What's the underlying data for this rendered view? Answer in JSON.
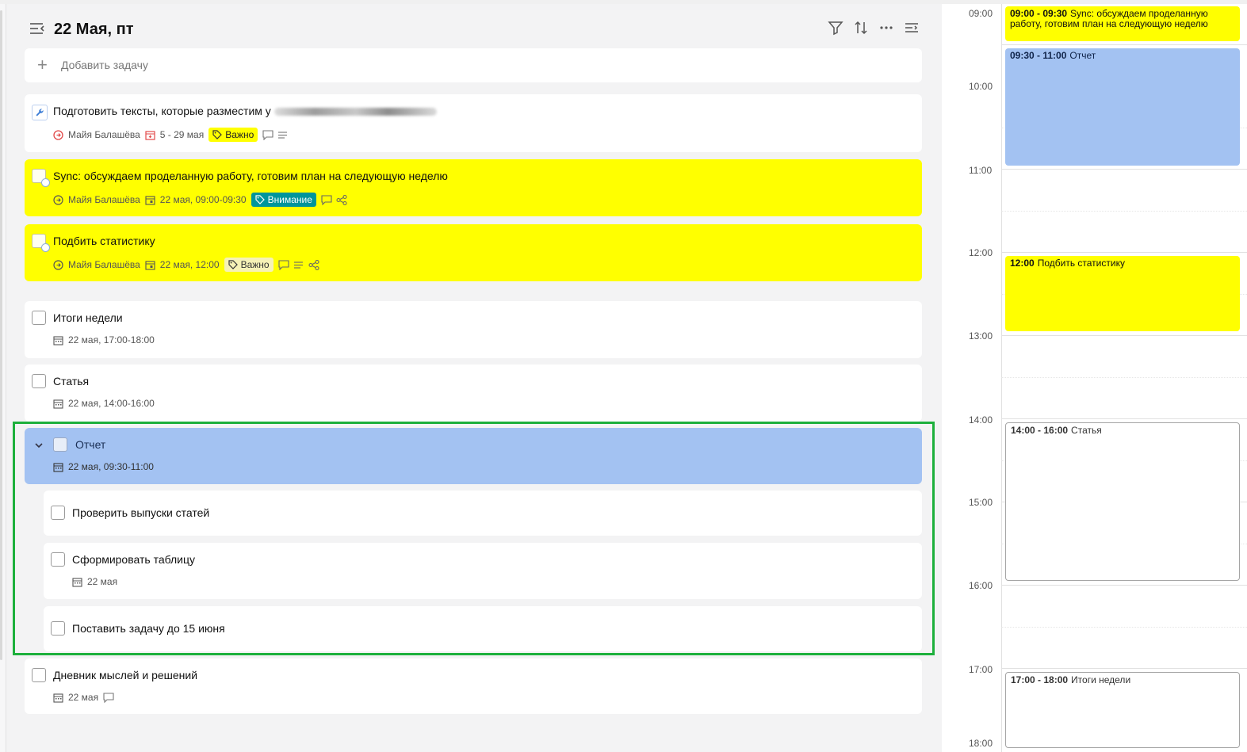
{
  "header": {
    "title": "22 Мая, пт"
  },
  "add_task": {
    "placeholder": "Добавить задачу",
    "plus": "+"
  },
  "tasks": [
    {
      "title": "Подготовить тексты, которые разместим у",
      "assignee": "Майя Балашёва",
      "date": "5 - 29 мая",
      "tag": "Важно"
    },
    {
      "title": "Sync: обсуждаем проделанную работу, готовим план на следующую неделю",
      "assignee": "Майя Балашёва",
      "date": "22 мая, 09:00-09:30",
      "tag": "Внимание"
    },
    {
      "title": "Подбить статистику",
      "assignee": "Майя Балашёва",
      "date": "22 мая, 12:00",
      "tag": "Важно"
    },
    {
      "title": "Итоги недели",
      "date": "22 мая, 17:00-18:00"
    },
    {
      "title": "Статья",
      "date": "22 мая, 14:00-16:00"
    },
    {
      "title": "Отчет",
      "date": "22 мая, 09:30-11:00",
      "subtasks": [
        {
          "title": "Проверить выпуски статей"
        },
        {
          "title": "Сформировать таблицу",
          "date": "22 мая"
        },
        {
          "title": "Поставить задачу до 15 июня"
        }
      ]
    },
    {
      "title": "Дневник мыслей и решений",
      "date": "22 мая"
    }
  ],
  "calendar": {
    "hours": [
      "09:00",
      "10:00",
      "11:00",
      "12:00",
      "13:00",
      "14:00",
      "15:00",
      "16:00",
      "17:00",
      "18:00"
    ],
    "events": [
      {
        "time": "09:00 - 09:30",
        "title": "Sync: обсуждаем проделанную работу, готовим план на следующую неделю",
        "color": "#ffff00"
      },
      {
        "time": "09:30 - 11:00",
        "title": "Отчет",
        "color": "#a3c2f2"
      },
      {
        "time": "12:00",
        "title": "Подбить статистику",
        "color": "#ffff00"
      },
      {
        "time": "14:00 - 16:00",
        "title": "Статья",
        "color": "#ffffff"
      },
      {
        "time": "17:00 - 18:00",
        "title": "Итоги недели",
        "color": "#ffffff"
      }
    ]
  },
  "colors": {
    "yellow_highlight": "#ffff00",
    "selected_blue": "#a3c2f2",
    "tag_teal": "#00959b",
    "frame_green": "#1db03c"
  }
}
